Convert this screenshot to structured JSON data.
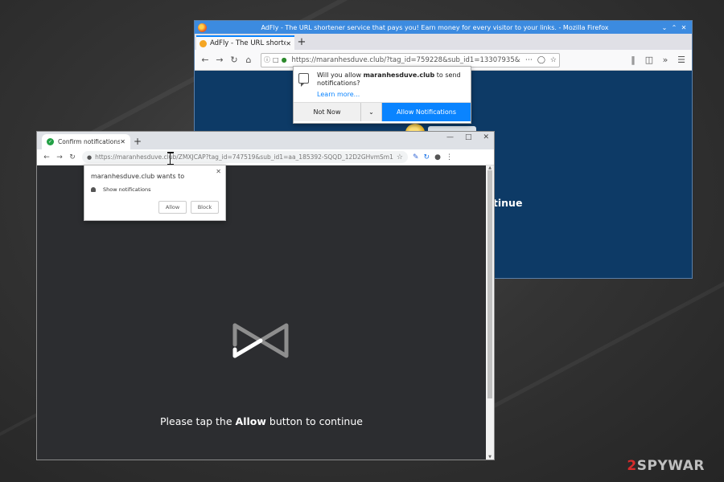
{
  "firefox": {
    "window_title": "AdFly - The URL shortener service that pays you! Earn money for every visitor to your links. - Mozilla Firefox",
    "tab_title": "AdFly - The URL shortener",
    "url": "https://maranhesduve.club/?tag_id=759228&sub_id1=13307935&sub_i...",
    "popup": {
      "message_pre": "Will you allow ",
      "site": "maranhesduve.club",
      "message_post": " to send notifications?",
      "learn_more": "Learn more...",
      "not_now": "Not Now",
      "allow": "Allow Notifications"
    },
    "page_text": "ntinue"
  },
  "chrome": {
    "tab_title": "Confirm notifications",
    "url": "https://maranhesduve.club/ZMXJCAP?tag_id=747519&sub_id1=aa_185392-SQQD_12D2GHvmSm1l3nW&sub_i...",
    "popup": {
      "site_line": "maranhesduve.club wants to",
      "permission": "Show notifications",
      "allow": "Allow",
      "block": "Block"
    },
    "message": {
      "pre": "Please tap the ",
      "bold": "Allow",
      "post": " button to continue"
    }
  },
  "watermark": {
    "num": "2",
    "text": "SPYWAR"
  }
}
